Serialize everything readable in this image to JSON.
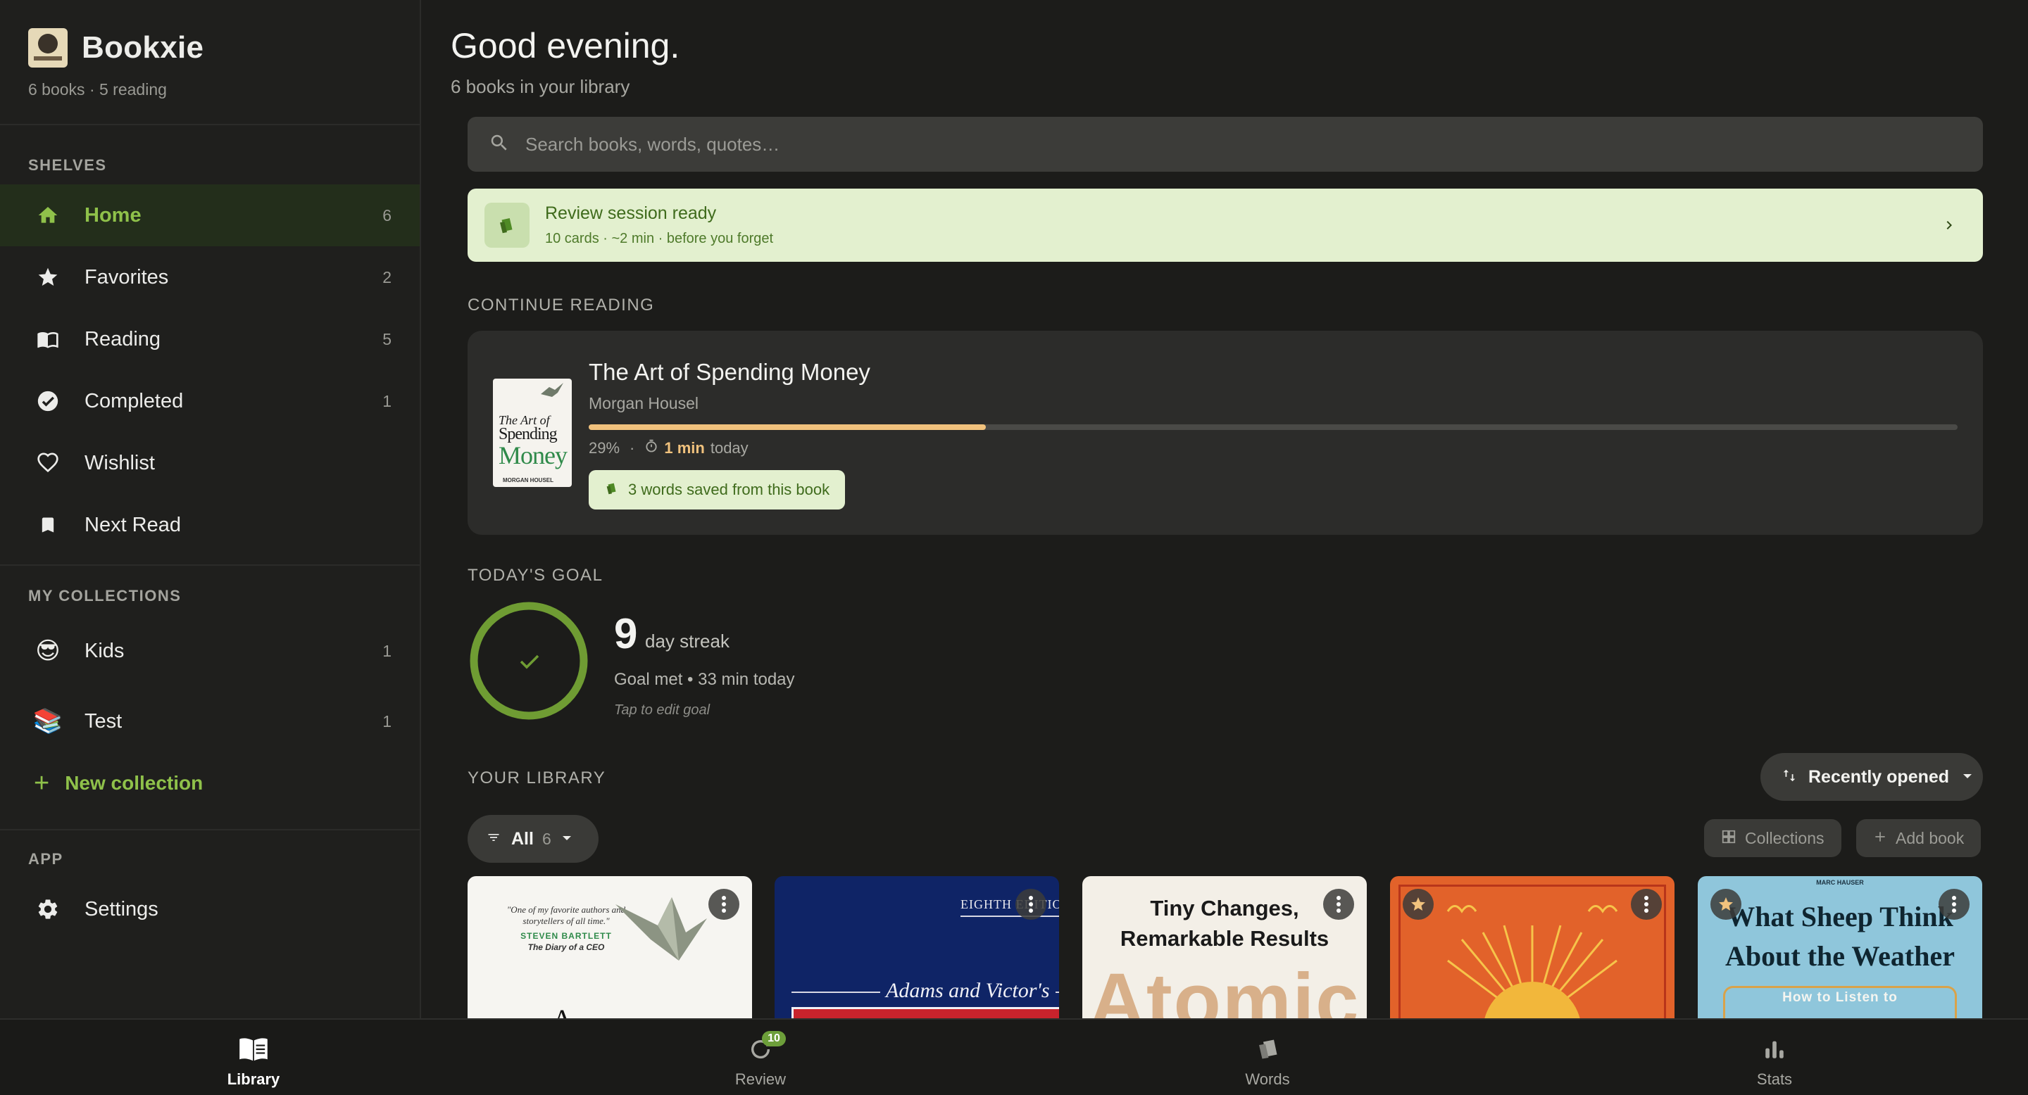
{
  "app": {
    "name": "Bookxie",
    "subtitle": "6 books · 5 reading"
  },
  "sidebar": {
    "shelves_label": "SHELVES",
    "shelves": [
      {
        "label": "Home",
        "count": "6",
        "icon": "home-icon",
        "active": true
      },
      {
        "label": "Favorites",
        "count": "2",
        "icon": "star-icon"
      },
      {
        "label": "Reading",
        "count": "5",
        "icon": "open-book-icon"
      },
      {
        "label": "Completed",
        "count": "1",
        "icon": "check-circle-icon"
      },
      {
        "label": "Wishlist",
        "count": "",
        "icon": "heart-icon"
      },
      {
        "label": "Next Read",
        "count": "",
        "icon": "bookmark-icon"
      }
    ],
    "collections_label": "MY COLLECTIONS",
    "collections": [
      {
        "label": "Kids",
        "count": "1",
        "emoji": "😎"
      },
      {
        "label": "Test",
        "count": "1",
        "emoji": "📚"
      }
    ],
    "new_collection": "New collection",
    "app_label": "APP",
    "settings": "Settings"
  },
  "main": {
    "greeting": "Good evening.",
    "greeting_sub": "6 books in your library",
    "search_placeholder": "Search books, words, quotes…",
    "review": {
      "title": "Review session ready",
      "subtitle": "10 cards · ~2 min · before you forget"
    },
    "continue_label": "CONTINUE READING",
    "current_book": {
      "title": "The Art of Spending Money",
      "author": "Morgan Housel",
      "progress_percent": 29,
      "progress_text": "29%",
      "time_today": "1 min",
      "time_suffix": "today",
      "words_saved": "3 words saved from this book",
      "cover": {
        "line1": "The Art of",
        "line2": "Spending",
        "line3": "Money",
        "author": "MORGAN HOUSEL"
      }
    },
    "goal_label": "TODAY'S GOAL",
    "goal": {
      "streak": "9",
      "streak_label": "day streak",
      "status": "Goal met • 33 min today",
      "tap_hint": "Tap to edit goal"
    },
    "library_label": "YOUR LIBRARY",
    "sort": "Recently opened",
    "filter": {
      "label": "All",
      "count": "6"
    },
    "collections_btn": "Collections",
    "add_book_btn": "Add book",
    "covers": [
      {
        "quote": "\"One of my favorite authors and storytellers of all time.\"",
        "endorser": "STEVEN BARTLETT",
        "endorser_sub": "The Diary of a CEO",
        "bg": "#f6f5f1"
      },
      {
        "edition": "EIGHTH EDITION",
        "title": "Adams and Victor's",
        "bg": "#0f2466"
      },
      {
        "title_line1": "Tiny Changes,",
        "title_line2": "Remarkable Results",
        "big": "Atomic",
        "bg": "#f3efe7"
      },
      {
        "bg": "#e2622a",
        "favorite": true
      },
      {
        "top": "MARC HAUSER",
        "title_line1": "What Sheep Think",
        "title_line2": "About the Weather",
        "subtitle": "How to Listen to",
        "bg": "#8fc6db",
        "favorite": true
      }
    ]
  },
  "bottom_nav": {
    "items": [
      {
        "label": "Library",
        "icon": "library-icon",
        "active": true
      },
      {
        "label": "Review",
        "icon": "review-icon",
        "badge": "10"
      },
      {
        "label": "Words",
        "icon": "cards-icon"
      },
      {
        "label": "Stats",
        "icon": "bar-chart-icon"
      }
    ]
  },
  "colors": {
    "accent": "#8fc14a",
    "progress": "#f1c27d",
    "banner": "#e3f0cf"
  }
}
